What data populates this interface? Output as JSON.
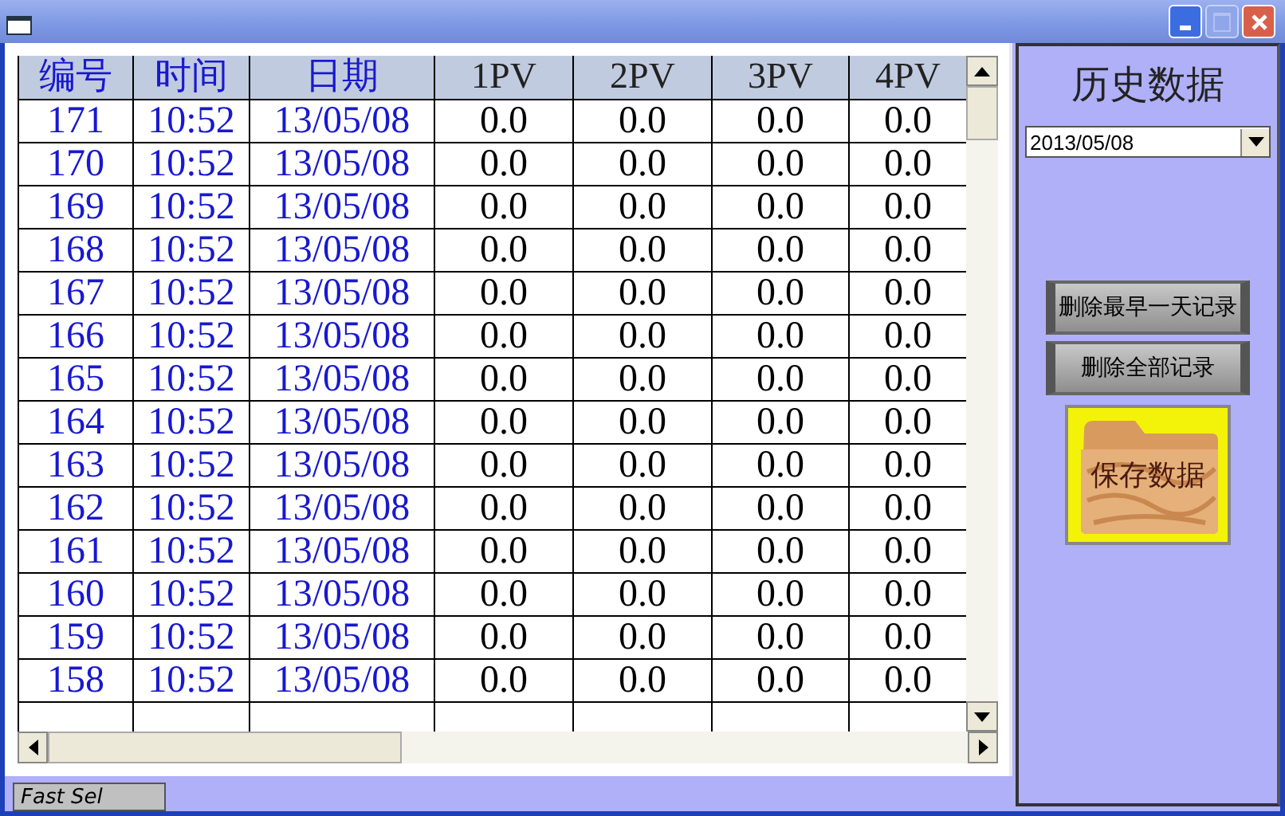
{
  "table": {
    "columns": [
      "编号",
      "时间",
      "日期",
      "1PV",
      "2PV",
      "3PV",
      "4PV"
    ],
    "rows": [
      [
        "171",
        "10:52",
        "13/05/08",
        "0.0",
        "0.0",
        "0.0",
        "0.0"
      ],
      [
        "170",
        "10:52",
        "13/05/08",
        "0.0",
        "0.0",
        "0.0",
        "0.0"
      ],
      [
        "169",
        "10:52",
        "13/05/08",
        "0.0",
        "0.0",
        "0.0",
        "0.0"
      ],
      [
        "168",
        "10:52",
        "13/05/08",
        "0.0",
        "0.0",
        "0.0",
        "0.0"
      ],
      [
        "167",
        "10:52",
        "13/05/08",
        "0.0",
        "0.0",
        "0.0",
        "0.0"
      ],
      [
        "166",
        "10:52",
        "13/05/08",
        "0.0",
        "0.0",
        "0.0",
        "0.0"
      ],
      [
        "165",
        "10:52",
        "13/05/08",
        "0.0",
        "0.0",
        "0.0",
        "0.0"
      ],
      [
        "164",
        "10:52",
        "13/05/08",
        "0.0",
        "0.0",
        "0.0",
        "0.0"
      ],
      [
        "163",
        "10:52",
        "13/05/08",
        "0.0",
        "0.0",
        "0.0",
        "0.0"
      ],
      [
        "162",
        "10:52",
        "13/05/08",
        "0.0",
        "0.0",
        "0.0",
        "0.0"
      ],
      [
        "161",
        "10:52",
        "13/05/08",
        "0.0",
        "0.0",
        "0.0",
        "0.0"
      ],
      [
        "160",
        "10:52",
        "13/05/08",
        "0.0",
        "0.0",
        "0.0",
        "0.0"
      ],
      [
        "159",
        "10:52",
        "13/05/08",
        "0.0",
        "0.0",
        "0.0",
        "0.0"
      ],
      [
        "158",
        "10:52",
        "13/05/08",
        "0.0",
        "0.0",
        "0.0",
        "0.0"
      ]
    ]
  },
  "tab": {
    "label": "Fast Sel"
  },
  "side": {
    "title": "历史数据",
    "date": "2013/05/08",
    "buttons": [
      "删除最早一天记录",
      "删除全部记录"
    ],
    "save": "保存数据"
  }
}
